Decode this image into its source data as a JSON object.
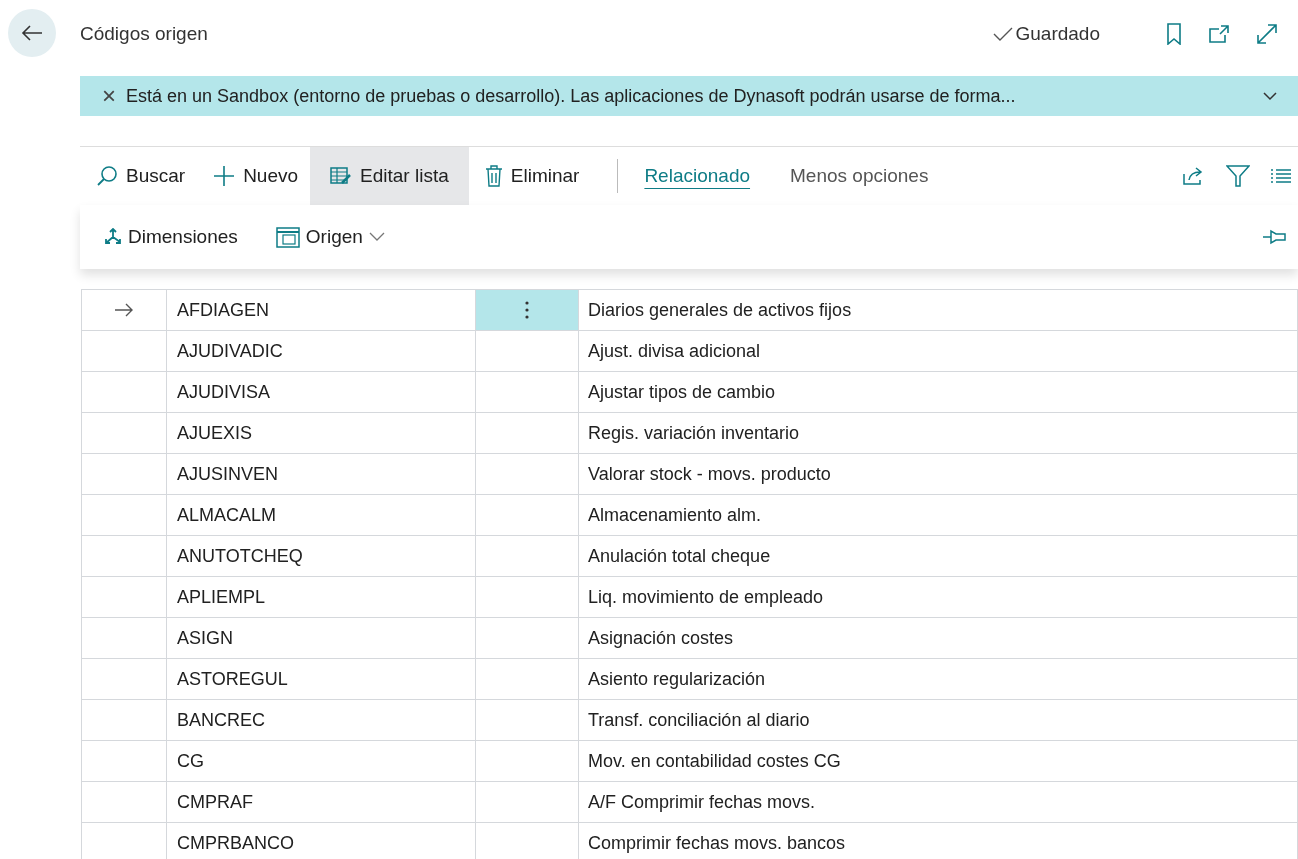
{
  "page": {
    "title": "Códigos origen",
    "save_status": "Guardado"
  },
  "banner": {
    "text": "Está en un Sandbox (entorno de pruebas o desarrollo). Las aplicaciones de Dynasoft podrán usarse de forma...",
    "close": "×"
  },
  "actions": [
    {
      "label": "Buscar",
      "kind": "search",
      "selected": false
    },
    {
      "label": "Nuevo",
      "kind": "new",
      "selected": false
    },
    {
      "label": "Editar lista",
      "kind": "edit",
      "selected": true
    },
    {
      "label": "Eliminar",
      "kind": "delete",
      "selected": false
    }
  ],
  "tabs": [
    {
      "label": "Relacionado",
      "selected": true
    },
    {
      "label": "Menos opciones",
      "selected": false
    }
  ],
  "submenu": [
    {
      "label": "Dimensiones",
      "kind": "dimensions"
    },
    {
      "label": "Origen",
      "kind": "source"
    }
  ],
  "rows": [
    {
      "code": "AFDIAGEN",
      "description": "Diarios generales de activos fijos",
      "selected": true
    },
    {
      "code": "AJUDIVADIC",
      "description": "Ajust. divisa adicional",
      "selected": false
    },
    {
      "code": "AJUDIVISA",
      "description": "Ajustar tipos de cambio",
      "selected": false
    },
    {
      "code": "AJUEXIS",
      "description": "Regis. variación inventario",
      "selected": false
    },
    {
      "code": "AJUSINVEN",
      "description": "Valorar stock - movs. producto",
      "selected": false
    },
    {
      "code": "ALMACALM",
      "description": "Almacenamiento alm.",
      "selected": false
    },
    {
      "code": "ANUTOTCHEQ",
      "description": "Anulación total cheque",
      "selected": false
    },
    {
      "code": "APLIEMPL",
      "description": "Liq. movimiento de empleado",
      "selected": false
    },
    {
      "code": "ASIGN",
      "description": "Asignación costes",
      "selected": false
    },
    {
      "code": "ASTOREGUL",
      "description": "Asiento regularización",
      "selected": false
    },
    {
      "code": "BANCREC",
      "description": "Transf. conciliación al diario",
      "selected": false
    },
    {
      "code": "CG",
      "description": "Mov. en contabilidad costes CG",
      "selected": false
    },
    {
      "code": "CMPRAF",
      "description": "A/F Comprimir fechas movs.",
      "selected": false
    },
    {
      "code": "CMPRBANCO",
      "description": "Comprimir fechas movs. bancos",
      "selected": false
    }
  ]
}
